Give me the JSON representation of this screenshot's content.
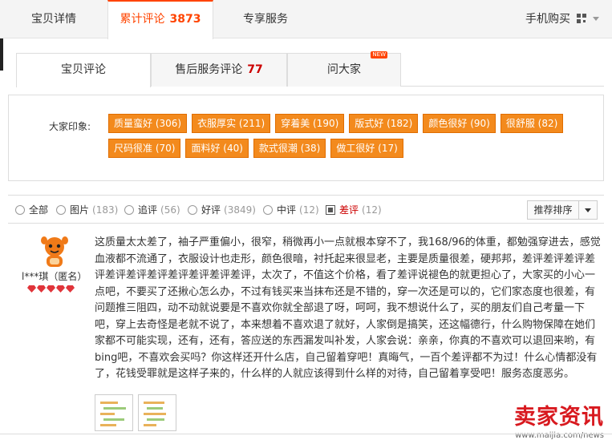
{
  "top_tabs": {
    "detail": "宝贝详情",
    "reviews_label": "累计评论",
    "reviews_count": "3873",
    "service": "专享服务",
    "mobile": "手机购买"
  },
  "sub_tabs": {
    "product_review": "宝贝评论",
    "after_sales_label": "售后服务评论",
    "after_sales_count": "77",
    "ask": "问大家",
    "new_badge": "NEW"
  },
  "impressions": {
    "label": "大家印象:",
    "tags": [
      [
        "质量蛮好 (306)",
        "衣服厚实 (211)",
        "穿着美 (190)",
        "版式好 (182)",
        "颜色很好 (90)",
        "很舒服 (82)"
      ],
      [
        "尺码很准 (70)",
        "面料好 (40)",
        "款式很潮 (38)",
        "做工很好 (17)"
      ]
    ]
  },
  "filters": [
    {
      "label": "全部",
      "count": ""
    },
    {
      "label": "图片",
      "count": "(183)"
    },
    {
      "label": "追评",
      "count": "(56)"
    },
    {
      "label": "好评",
      "count": "(3849)"
    },
    {
      "label": "中评",
      "count": "(12)"
    },
    {
      "label": "差评",
      "count": "(12)"
    }
  ],
  "sort_label": "推荐排序",
  "review": {
    "username": "l***琪（匿名）",
    "text": "这质量太太差了，袖子严重偏小，很窄，稍微再小一点就根本穿不了，我168/96的体重，都勉强穿进去，感觉血液都不流通了，衣服设计也走形，颜色很暗，衬托起来很显老，主要是质量很差，硬邦邦，差评差评差评差评差评差评差评差评差评差评差评，太次了，不值这个价格，看了差评说褪色的就更担心了，大家买的小心一点吧，不要买了还揪心怎么办，不过有钱买来当抹布还是不错的，穿一次还是可以的，它们家态度也很差，有问题推三阻四，动不动就说要是不喜欢你就全部退了呀，呵呵，我不想说什么了，买的朋友们自己考量一下吧，穿上去奇怪是老就不说了，本来想着不喜欢退了就好，人家倒是搞笑，还这幅德行，什么购物保障在她们家都不可能实现，还有，还有，答应送的东西漏发叫补发，人家会说：亲亲，你真的不喜欢可以退回来哟，有bing吧，不喜欢会买吗？你这样还开什么店，自己留着穿吧！真晦气，一百个差评都不为过！什么心情都没有了，花钱受罪就是这样子来的，什么样的人就应该得到什么样的对待，自己留着享受吧！服务态度恶劣。"
  },
  "watermark": {
    "main": "卖家资讯",
    "url": "www.maijia.com/news"
  },
  "colors": {
    "accent": "#ff4400",
    "tag_bg": "#f38a1d",
    "count_red": "#cc0000"
  }
}
